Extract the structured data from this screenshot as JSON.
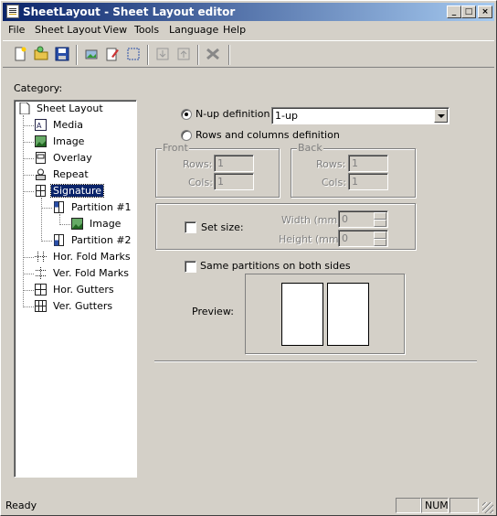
{
  "window": {
    "title": "SheetLayout - Sheet Layout editor",
    "controls": [
      "minimize",
      "maximize",
      "close"
    ]
  },
  "menu": [
    "File",
    "Sheet Layout",
    "View",
    "Tools",
    "Language",
    "Help"
  ],
  "toolbar": {
    "icons": [
      "new-icon",
      "open-icon",
      "save-icon",
      "image-icon",
      "edit-icon",
      "select-icon",
      "move-down-icon",
      "move-up-icon",
      "delete-icon"
    ]
  },
  "category": {
    "label": "Category:",
    "tree": [
      {
        "label": "Sheet Layout",
        "icon": "page-icon"
      },
      {
        "label": "Media",
        "icon": "media-icon"
      },
      {
        "label": "Image",
        "icon": "image-icon"
      },
      {
        "label": "Overlay",
        "icon": "overlay-icon"
      },
      {
        "label": "Repeat",
        "icon": "repeat-icon"
      },
      {
        "label": "Signature",
        "icon": "signature-icon",
        "selected": true
      },
      {
        "label": "Partition #1",
        "icon": "partition-icon"
      },
      {
        "label": "Image",
        "icon": "image-icon"
      },
      {
        "label": "Partition #2",
        "icon": "partition-icon"
      },
      {
        "label": "Hor. Fold Marks",
        "icon": "hfold-icon"
      },
      {
        "label": "Ver. Fold Marks",
        "icon": "vfold-icon"
      },
      {
        "label": "Hor. Gutters",
        "icon": "hgutter-icon"
      },
      {
        "label": "Ver. Gutters",
        "icon": "vgutter-icon"
      }
    ]
  },
  "signature": {
    "nup_label": "N-up definition",
    "nup_value": "1-up",
    "rowscols_label": "Rows and columns definition",
    "front": {
      "title": "Front",
      "rows_label": "Rows:",
      "rows_value": "1",
      "cols_label": "Cols:",
      "cols_value": "1"
    },
    "back": {
      "title": "Back",
      "rows_label": "Rows:",
      "rows_value": "1",
      "cols_label": "Cols:",
      "cols_value": "1"
    },
    "setsize_label": "Set size:",
    "width_label": "Width (mm):",
    "width_value": "0",
    "height_label": "Height (mm):",
    "height_value": "0",
    "same_partitions_label": "Same partitions on both sides",
    "preview_label": "Preview:"
  },
  "status": {
    "text": "Ready",
    "num": "NUM"
  }
}
